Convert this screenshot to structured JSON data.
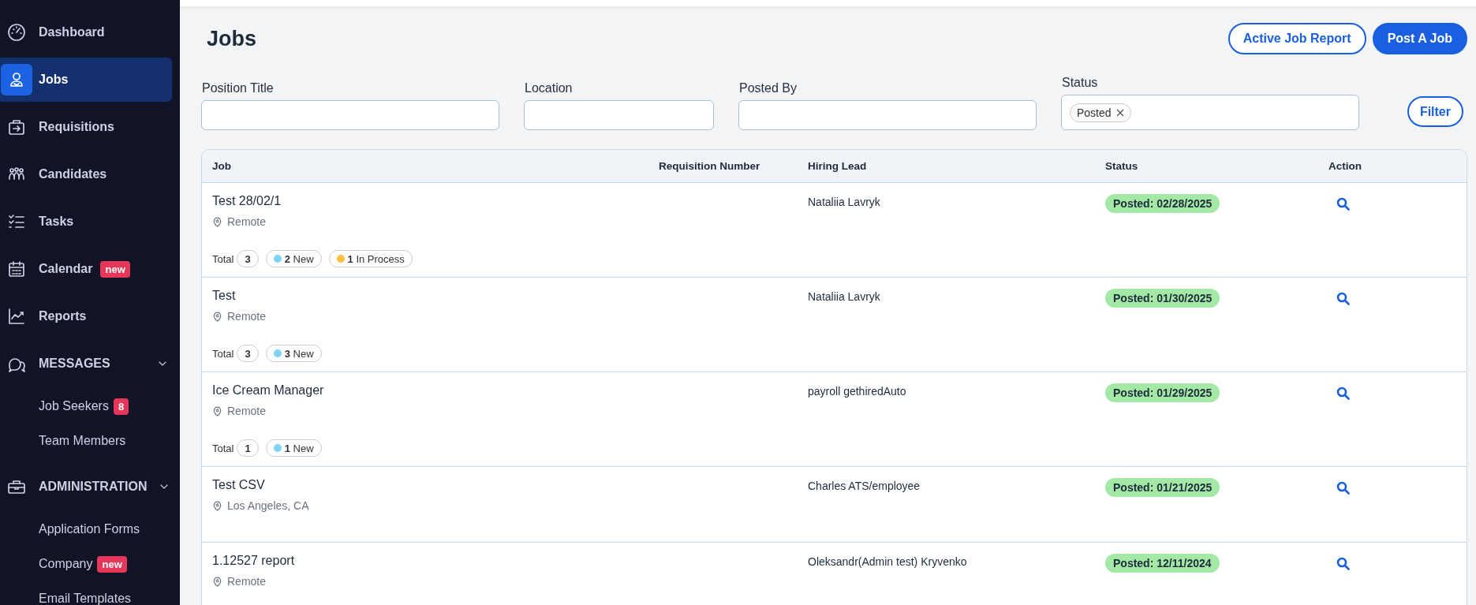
{
  "sidebar": {
    "items": [
      {
        "label": "Dashboard",
        "kind": "link",
        "selected": false
      },
      {
        "label": "Jobs",
        "kind": "link",
        "selected": true
      },
      {
        "label": "Requisitions",
        "kind": "link",
        "selected": false
      },
      {
        "label": "Candidates",
        "kind": "link",
        "selected": false
      },
      {
        "label": "Tasks",
        "kind": "link",
        "selected": false
      },
      {
        "label": "Calendar",
        "kind": "link",
        "selected": false,
        "badge": "new"
      },
      {
        "label": "Reports",
        "kind": "link",
        "selected": false
      },
      {
        "label": "MESSAGES",
        "kind": "section",
        "expanded": true,
        "children": [
          {
            "label": "Job Seekers",
            "selected": false,
            "badge": "8"
          },
          {
            "label": "Team Members",
            "selected": false
          }
        ]
      },
      {
        "label": "ADMINISTRATION",
        "kind": "section",
        "expanded": true,
        "children": [
          {
            "label": "Application Forms",
            "selected": false
          },
          {
            "label": "Company",
            "selected": false,
            "badge": "new"
          },
          {
            "label": "Email Templates",
            "selected": false
          }
        ]
      }
    ]
  },
  "header": {
    "title": "Jobs",
    "buttons": [
      {
        "label": "Active Job Report",
        "kind": "outline"
      },
      {
        "label": "Post A Job",
        "kind": "primary"
      }
    ]
  },
  "filters": {
    "fields": [
      {
        "label": "Position Title"
      },
      {
        "label": "Location"
      },
      {
        "label": "Posted By"
      },
      {
        "label": "Status",
        "tags": [
          "Posted"
        ]
      }
    ],
    "button": "Filter"
  },
  "table": {
    "columns": [
      "Job",
      "Requisition Number",
      "Hiring Lead",
      "Status",
      "Action"
    ],
    "rows": [
      {
        "job": "Test 28/02/1",
        "location": "Remote",
        "total_label": "Total",
        "total": "3",
        "counts": [
          {
            "text": "**2** New",
            "color": "#7dd3f5"
          },
          {
            "text": "**1** In Process",
            "color": "#fbbf3c"
          }
        ],
        "hiring_lead": "Nataliia Lavryk",
        "status": "Posted: 02/28/2025"
      },
      {
        "job": "Test",
        "location": "Remote",
        "total_label": "Total",
        "total": "3",
        "counts": [
          {
            "text": "**3** New",
            "color": "#7dd3f5"
          }
        ],
        "hiring_lead": "Nataliia Lavryk",
        "status": "Posted: 01/30/2025"
      },
      {
        "job": "Ice Cream Manager",
        "location": "Remote",
        "total_label": "Total",
        "total": "1",
        "counts": [
          {
            "text": "**1** New",
            "color": "#7dd3f5"
          }
        ],
        "hiring_lead": "payroll gethiredAuto",
        "status": "Posted: 01/29/2025"
      },
      {
        "job": "Test CSV",
        "location": "Los Angeles, CA",
        "hiring_lead": "Charles ATS/employee",
        "status": "Posted: 01/21/2025"
      },
      {
        "job": "1.12527 report",
        "location": "Remote",
        "hiring_lead": "Oleksandr(Admin test) Kryvenko",
        "status": "Posted: 12/11/2024"
      }
    ]
  }
}
